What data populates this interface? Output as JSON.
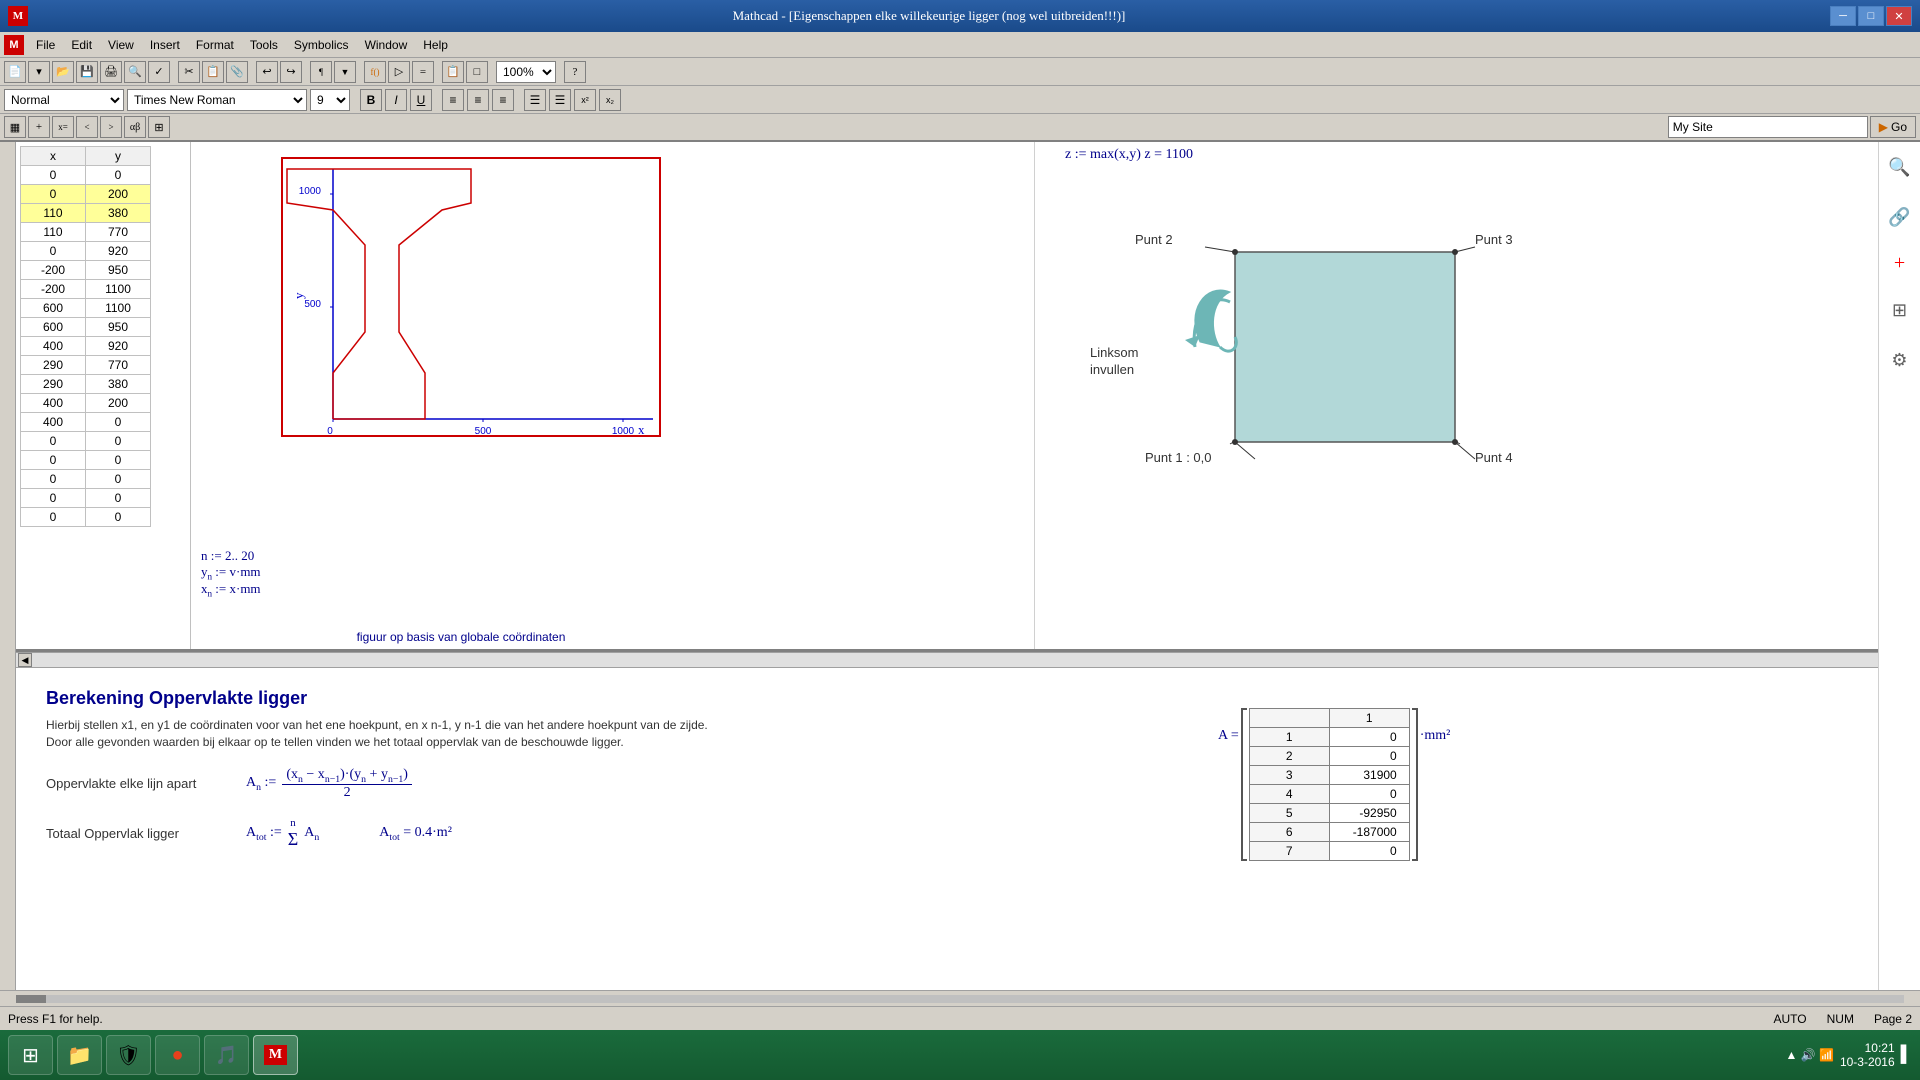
{
  "titlebar": {
    "icon": "M",
    "title": "Mathcad - [Eigenschappen elke willekeurige ligger (nog wel uitbreiden!!!)]",
    "min": "─",
    "max": "□",
    "close": "✕"
  },
  "menubar": {
    "items": [
      "File",
      "Edit",
      "View",
      "Insert",
      "Format",
      "Tools",
      "Symbolics",
      "Window",
      "Help"
    ]
  },
  "toolbar2": {
    "style": "Normal",
    "font": "Times New Roman",
    "size": "9",
    "bold": "B",
    "italic": "I",
    "underline": "U"
  },
  "toolbar3": {
    "site_placeholder": "My Site",
    "go_label": "Go"
  },
  "table": {
    "headers": [
      "x",
      "y"
    ],
    "rows": [
      [
        "0",
        "0"
      ],
      [
        "0",
        "200"
      ],
      [
        "110",
        "380"
      ],
      [
        "110",
        "770"
      ],
      [
        "0",
        "920"
      ],
      [
        "-200",
        "950"
      ],
      [
        "-200",
        "1100"
      ],
      [
        "600",
        "1100"
      ],
      [
        "600",
        "950"
      ],
      [
        "400",
        "920"
      ],
      [
        "290",
        "770"
      ],
      [
        "290",
        "380"
      ],
      [
        "400",
        "200"
      ],
      [
        "400",
        "0"
      ],
      [
        "0",
        "0"
      ],
      [
        "0",
        "0"
      ],
      [
        "0",
        "0"
      ],
      [
        "0",
        "0"
      ],
      [
        "0",
        "0"
      ]
    ]
  },
  "graph": {
    "caption": "figuur op basis van globale coördinaten",
    "xlabel": "x",
    "ylabel": "y",
    "x_ticks": [
      "0",
      "500",
      "1000"
    ],
    "y_ticks": [
      "500",
      "1000"
    ]
  },
  "formulas": {
    "z_formula": "z := max(x,y)   z = 1100",
    "n_formula": "n := 2.. 20",
    "yn_formula": "y := v·mm",
    "xn_formula": "x := x·mm",
    "diagram_labels": {
      "punt1": "Punt 1 :  0,0",
      "punt2": "Punt 2",
      "punt3": "Punt 3",
      "punt4": "Punt 4",
      "linksom": "Linksom",
      "invullen": "invullen"
    }
  },
  "bottom_section": {
    "title": "Berekening Oppervlakte ligger",
    "description1": "Hierbij stellen x1, en y1 de coördinaten voor van het ene hoekpunt, en x n-1, y n-1 die van het andere hoekpunt van de zijde.",
    "description2": "Door alle gevonden waarden bij elkaar op te tellen vinden we het totaal oppervlak van de beschouwde ligger.",
    "label1": "Oppervlakte elke lijn apart",
    "label2": "Totaal Oppervlak ligger",
    "formula1_label": "A",
    "formula1_sub": "n",
    "formula2_label": "A",
    "formula2_sub": "tot",
    "result": "A",
    "result_sub": "tot",
    "result_val": "= 0.4·m²",
    "matrix_label": "A =",
    "matrix_unit": "·mm²",
    "matrix_col_header": "1",
    "matrix_rows": [
      {
        "index": "1",
        "value": "0"
      },
      {
        "index": "2",
        "value": "0"
      },
      {
        "index": "3",
        "value": "31900"
      },
      {
        "index": "4",
        "value": "0"
      },
      {
        "index": "5",
        "value": "-92950"
      },
      {
        "index": "6",
        "value": "-187000"
      },
      {
        "index": "7",
        "value": "0"
      }
    ]
  },
  "statusbar": {
    "help_text": "Press F1 for help.",
    "auto": "AUTO",
    "num": "NUM",
    "page": "Page 2"
  },
  "taskbar": {
    "time": "10:21",
    "date": "10-3-2016",
    "apps": [
      "⊞",
      "📁",
      "🛡",
      "●",
      "🎵",
      "M"
    ]
  },
  "icons": {
    "search": "🔍",
    "settings": "⚙",
    "windows": "⊞",
    "connect": "🔗",
    "plus": "+"
  }
}
